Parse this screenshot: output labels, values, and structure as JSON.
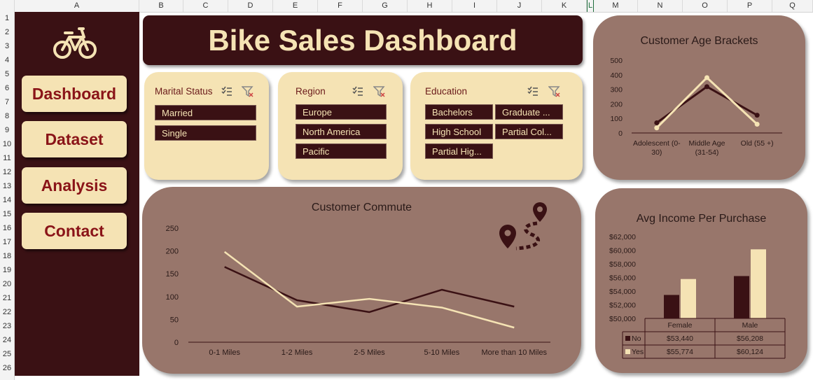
{
  "spreadsheet": {
    "columns": [
      "A",
      "B",
      "C",
      "D",
      "E",
      "F",
      "G",
      "H",
      "I",
      "J",
      "K",
      "L",
      "M",
      "N",
      "O",
      "P",
      "Q"
    ],
    "rows": [
      "1",
      "2",
      "3",
      "4",
      "5",
      "6",
      "7",
      "8",
      "9",
      "10",
      "11",
      "12",
      "13",
      "14",
      "15",
      "16",
      "17",
      "18",
      "19",
      "20",
      "21",
      "22",
      "23",
      "24",
      "25",
      "26"
    ]
  },
  "nav": {
    "items": [
      {
        "label": "Dashboard"
      },
      {
        "label": "Dataset"
      },
      {
        "label": "Analysis"
      },
      {
        "label": "Contact"
      }
    ]
  },
  "header": {
    "title": "Bike Sales Dashboard"
  },
  "slicers": {
    "marital": {
      "title": "Marital Status",
      "items": [
        "Married",
        "Single"
      ]
    },
    "region": {
      "title": "Region",
      "items": [
        "Europe",
        "North America",
        "Pacific"
      ]
    },
    "education": {
      "title": "Education",
      "items": [
        "Bachelors",
        "Graduate ...",
        "High School",
        "Partial Col...",
        "Partial Hig..."
      ]
    }
  },
  "colors": {
    "dark": "#3a1114",
    "cream": "#f5e3b4",
    "panel": "#98766b",
    "accent": "#8a1418"
  },
  "chart_data": [
    {
      "id": "age",
      "type": "line",
      "title": "Customer Age Brackets",
      "categories": [
        "Adolescent (0-30)",
        "Middle Age (31-54)",
        "Old (55 +)"
      ],
      "category_lines": [
        [
          "Adolescent (0-",
          "30)"
        ],
        [
          "Middle Age",
          "(31-54)"
        ],
        [
          "Old (55 +)"
        ]
      ],
      "series": [
        {
          "values": [
            70,
            318,
            122
          ],
          "color": "#3a1114"
        },
        {
          "values": [
            35,
            380,
            60
          ],
          "color": "#f5e3b4"
        }
      ],
      "ylim": [
        0,
        500
      ],
      "yticks": [
        0,
        100,
        200,
        300,
        400,
        500
      ],
      "markers": true
    },
    {
      "id": "commute",
      "type": "line",
      "title": "Customer Commute",
      "categories": [
        "0-1 Miles",
        "1-2 Miles",
        "2-5 Miles",
        "5-10 Miles",
        "More than 10 Miles"
      ],
      "series": [
        {
          "values": [
            165,
            92,
            66,
            115,
            78
          ],
          "color": "#3a1114"
        },
        {
          "values": [
            198,
            78,
            95,
            76,
            32
          ],
          "color": "#f5e3b4"
        }
      ],
      "ylim": [
        0,
        250
      ],
      "yticks": [
        0,
        50,
        100,
        150,
        200,
        250
      ],
      "markers": false
    },
    {
      "id": "income",
      "type": "bar",
      "title": "Avg Income Per Purchase",
      "categories": [
        "Female",
        "Male"
      ],
      "series": [
        {
          "name": "No",
          "values": [
            53440,
            56208
          ],
          "labels": [
            "$53,440",
            "$56,208"
          ],
          "color": "#3a1114"
        },
        {
          "name": "Yes",
          "values": [
            55774,
            60124
          ],
          "labels": [
            "$55,774",
            "$60,124"
          ],
          "color": "#f5e3b4"
        }
      ],
      "ylim": [
        50000,
        62000
      ],
      "yticks": [
        50000,
        52000,
        54000,
        56000,
        58000,
        60000,
        62000
      ],
      "ytick_labels": [
        "$50,000",
        "$52,000",
        "$54,000",
        "$56,000",
        "$58,000",
        "$60,000",
        "$62,000"
      ]
    }
  ]
}
